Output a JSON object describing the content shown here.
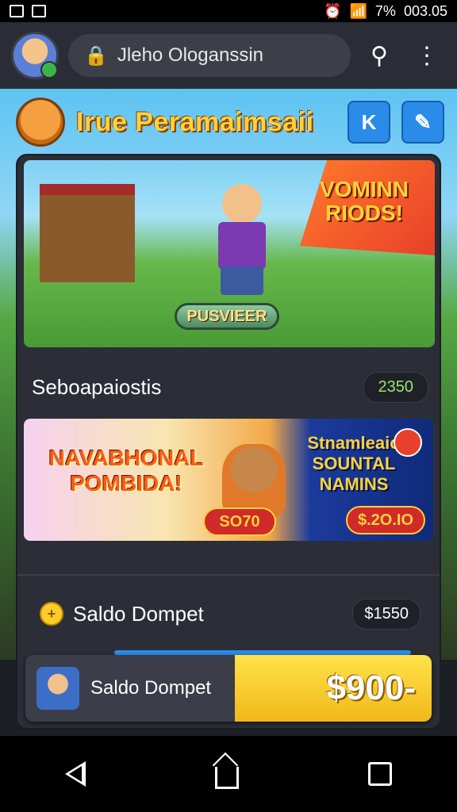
{
  "status_bar": {
    "time": "003.05",
    "battery": "7%"
  },
  "top_bar": {
    "search_text": "Jleho Ologanssin",
    "search_icon": "search-icon",
    "menu_icon": "more-vertical-icon"
  },
  "app_title": {
    "text": "Irue Peramaimsaii",
    "button_k": "K",
    "button_edit": "edit-icon"
  },
  "banner1": {
    "promo": "VOMINN RIODS!",
    "button": "PUSVIEER"
  },
  "section": {
    "title": "Seboapaiostis",
    "value": "2350"
  },
  "banner2": {
    "left_text": "NAVABHONAL POMBIDA!",
    "right_text": "Stnamleaio SOUNTAL NAMINS",
    "price1": "SO70",
    "price2": "$.2O.IO"
  },
  "wallet": {
    "label": "Saldo Dompet",
    "value": "$1550"
  },
  "bottom_card": {
    "label": "Saldo Dompet",
    "amount": "$900-"
  },
  "colors": {
    "accent_blue": "#2a8ce8",
    "gold": "#ffd23a",
    "panel": "#2b2e37"
  }
}
